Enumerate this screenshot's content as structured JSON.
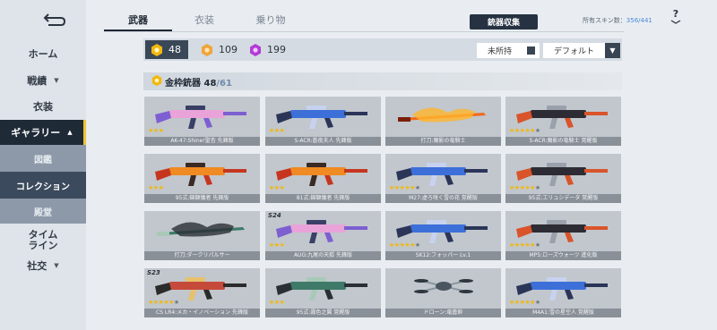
{
  "sidebar": {
    "items": [
      {
        "label": "ホーム",
        "caret": ""
      },
      {
        "label": "戦績",
        "caret": "▼"
      },
      {
        "label": "衣装",
        "caret": ""
      },
      {
        "label": "ギャラリー",
        "caret": "▲"
      },
      {
        "label": "図鑑",
        "caret": ""
      },
      {
        "label": "コレクション",
        "caret": ""
      },
      {
        "label": "殿堂",
        "caret": ""
      },
      {
        "label": "タイム\nライン",
        "caret": ""
      },
      {
        "label": "社交",
        "caret": "▼"
      }
    ]
  },
  "tabs": [
    {
      "label": "武器"
    },
    {
      "label": "衣装"
    },
    {
      "label": "乗り物"
    }
  ],
  "header": {
    "collect_button": "銃器収集",
    "skin_count_label": "所有スキン数：",
    "skin_count_value": "356/441",
    "help_icon": "?"
  },
  "filters": {
    "gold_count": "48",
    "orange_count": "109",
    "purple_count": "199",
    "unowned_label": "未所持",
    "sort_label": "デフォルト",
    "sort_arrow": "▼"
  },
  "section": {
    "title": "金枠銃器",
    "owned": "48",
    "total": "/61"
  },
  "colors": {
    "gold": "#f2b80d",
    "orange": "#f0a53a",
    "purple": "#b23bd6",
    "sidebar_active": "#1f2a37",
    "accent": "#f0c430"
  },
  "weapons": [
    {
      "name": "AK-47:Shine!聖杏 先鋒版",
      "stars": 3,
      "tag": "",
      "art": "pink"
    },
    {
      "name": "S-ACR:蒼夜夫人 先鋒版",
      "stars": 3,
      "tag": "",
      "art": "blue"
    },
    {
      "name": "打刀:魔影の竜騎士",
      "stars": 0,
      "tag": "",
      "art": "fire"
    },
    {
      "name": "S-ACR:魔影の竜騎士 覚醒版",
      "stars": 5,
      "tag": "",
      "art": "dark"
    },
    {
      "name": "95式:錦獅儀者 先鋒版",
      "stars": 3,
      "tag": "",
      "art": "orange"
    },
    {
      "name": "81式:錦獅儀者 先鋒版",
      "stars": 3,
      "tag": "",
      "art": "orange"
    },
    {
      "name": "M27:虚ろ咲く雪の花 覚醒版",
      "stars": 5,
      "tag": "",
      "art": "blue"
    },
    {
      "name": "95式:エリュシデータ 覚醒版",
      "stars": 5,
      "tag": "",
      "art": "dark"
    },
    {
      "name": "打刀:ダークリパルサー",
      "stars": 0,
      "tag": "",
      "art": "green"
    },
    {
      "name": "AUG:九尾の天狐 先鋒版",
      "stars": 3,
      "tag": "S24",
      "art": "pink"
    },
    {
      "name": "SK12:フォッパー Lv.1",
      "stars": 5,
      "tag": "",
      "art": "blue"
    },
    {
      "name": "MP5:ローズウォーツ 進化版",
      "stars": 5,
      "tag": "",
      "art": "dark"
    },
    {
      "name": "CS LR4:メカ・イノベーション 先鋒版",
      "stars": 5,
      "tag": "S23",
      "art": "red"
    },
    {
      "name": "95式:霧色之翼 覚醒版",
      "stars": 3,
      "tag": "",
      "art": "green"
    },
    {
      "name": "ドローン:竜蒼幹",
      "stars": 0,
      "tag": "",
      "art": "drone"
    },
    {
      "name": "M4A1:雪の星空人 覚醒版",
      "stars": 5,
      "tag": "",
      "art": "blue"
    }
  ]
}
